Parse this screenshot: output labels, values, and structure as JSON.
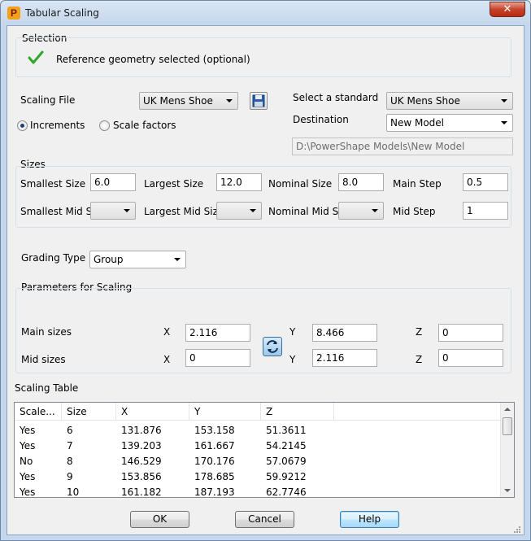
{
  "window": {
    "title": "Tabular Scaling",
    "app_icon_letter": "P",
    "close_glyph": "✕"
  },
  "selection": {
    "group_label": "Selection",
    "status_text": "Reference geometry selected (optional)",
    "status_color": "#2da82d"
  },
  "scaling_file": {
    "label": "Scaling File",
    "combo_value": "UK Mens Shoe",
    "radio_increments": "Increments",
    "radio_scale_factors": "Scale factors",
    "selected_mode": "Increments"
  },
  "standard": {
    "label": "Select a standard",
    "value": "UK Mens Shoe",
    "destination_label": "Destination",
    "destination_value": "New Model",
    "path_value": "D:\\PowerShape Models\\New Model"
  },
  "sizes": {
    "group_label": "Sizes",
    "smallest_label": "Smallest Size",
    "smallest_value": "6.0",
    "largest_label": "Largest Size",
    "largest_value": "12.0",
    "nominal_label": "Nominal Size",
    "nominal_value": "8.0",
    "main_step_label": "Main Step",
    "main_step_value": "0.5",
    "smallest_mid_label": "Smallest Mid Siz",
    "largest_mid_label": "Largest Mid Size",
    "nominal_mid_label": "Nominal Mid Siz",
    "mid_step_label": "Mid Step",
    "mid_step_value": "1"
  },
  "grading": {
    "label": "Grading Type",
    "value": "Group"
  },
  "parameters": {
    "group_label": "Parameters for Scaling",
    "main_label": "Main sizes",
    "mid_label": "Mid sizes",
    "x_label": "X",
    "y_label": "Y",
    "z_label": "Z",
    "main_x": "2.116",
    "main_y": "8.466",
    "main_z": "0",
    "mid_x": "0",
    "mid_y": "2.116",
    "mid_z": "0"
  },
  "table": {
    "label": "Scaling Table",
    "columns": [
      "Scale...",
      "Size",
      "X",
      "Y",
      "Z"
    ],
    "rows": [
      [
        "Yes",
        "6",
        "131.876",
        "153.158",
        "51.3611"
      ],
      [
        "Yes",
        "7",
        "139.203",
        "161.667",
        "54.2145"
      ],
      [
        "No",
        "8",
        "146.529",
        "170.176",
        "57.0679"
      ],
      [
        "Yes",
        "9",
        "153.856",
        "178.685",
        "59.9212"
      ],
      [
        "Yes",
        "10",
        "161.182",
        "187.193",
        "62.7746"
      ]
    ]
  },
  "buttons": {
    "ok": "OK",
    "cancel": "Cancel",
    "help": "Help"
  }
}
